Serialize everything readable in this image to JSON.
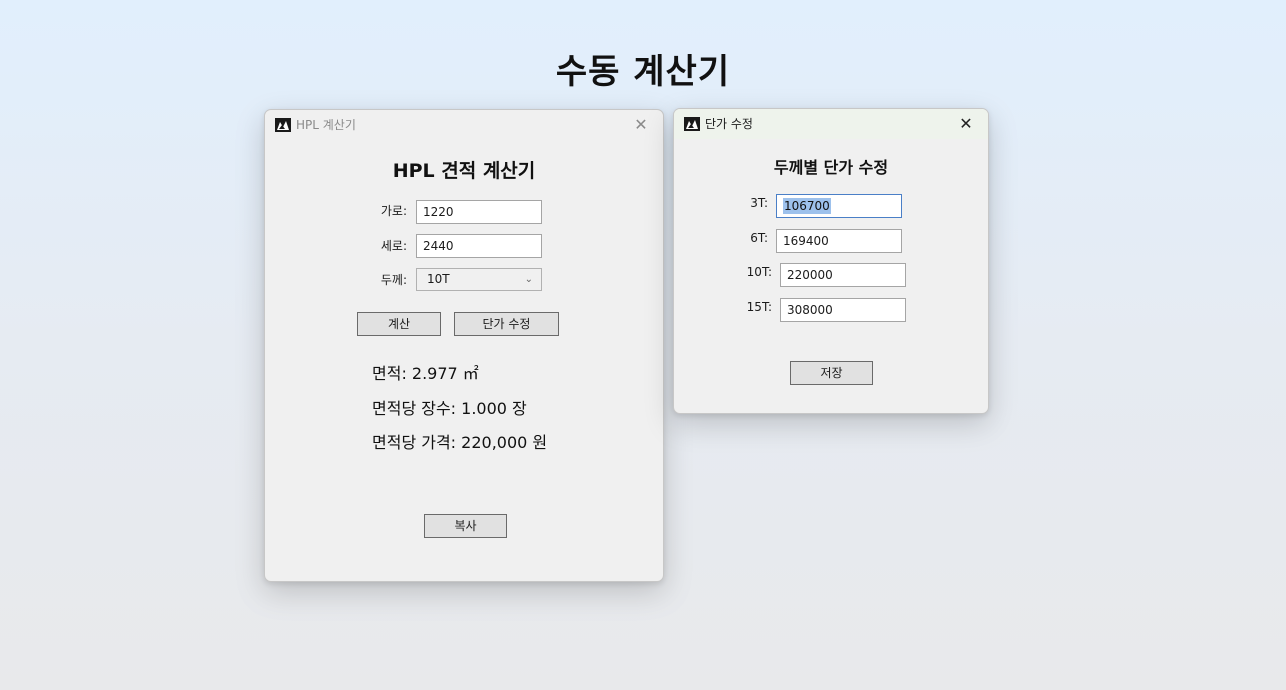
{
  "page": {
    "title": "수동 계산기"
  },
  "main_window": {
    "title": "HPL 계산기",
    "heading": "HPL 견적 계산기",
    "width_label": "가로:",
    "width_value": "1220",
    "height_label": "세로:",
    "height_value": "2440",
    "thickness_label": "두께:",
    "thickness_selected": "10T",
    "calc_button": "계산",
    "edit_price_button": "단가 수정",
    "area_text": "면적: 2.977 ㎡",
    "sheets_text": "면적당 장수: 1.000 장",
    "price_text": "면적당 가격: 220,000 원",
    "copy_button": "복사",
    "close_glyph": "✕"
  },
  "price_window": {
    "title": "단가 수정",
    "heading": "두께별 단가 수정",
    "rows": [
      {
        "label": "3T:",
        "value": "106700"
      },
      {
        "label": "6T:",
        "value": "169400"
      },
      {
        "label": "10T:",
        "value": "220000"
      },
      {
        "label": "15T:",
        "value": "308000"
      }
    ],
    "save_button": "저장",
    "close_glyph": "✕"
  },
  "icons": {
    "app_icon": "app-logo-icon",
    "close": "close-icon",
    "dropdown": "chevron-down-icon"
  }
}
